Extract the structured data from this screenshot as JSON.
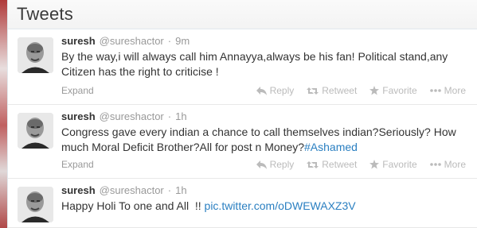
{
  "header": {
    "title": "Tweets"
  },
  "colors": {
    "link": "#2a7fc1",
    "muted": "#999999",
    "text": "#333333"
  },
  "tweets": [
    {
      "name": "suresh",
      "handle": "@sureshactor",
      "separator": "·",
      "time": "9m",
      "text": "By the way,i will always call him Annayya,always be his fan! Political stand,any Citizen has the right to criticise !",
      "expand": "Expand",
      "reply": "Reply",
      "retweet": "Retweet",
      "favorite": "Favorite",
      "more": "More"
    },
    {
      "name": "suresh",
      "handle": "@sureshactor",
      "separator": "·",
      "time": "1h",
      "text": "Congress gave every indian a chance to call themselves indian?Seriously? How much Moral Deficit Brother?All for post n Money?",
      "hashtag": "#Ashamed",
      "expand": "Expand",
      "reply": "Reply",
      "retweet": "Retweet",
      "favorite": "Favorite",
      "more": "More"
    },
    {
      "name": "suresh",
      "handle": "@sureshactor",
      "separator": "·",
      "time": "1h",
      "text": "Happy Holi To one and All  !! ",
      "link": "pic.twitter.com/oDWEWAXZ3V"
    }
  ]
}
